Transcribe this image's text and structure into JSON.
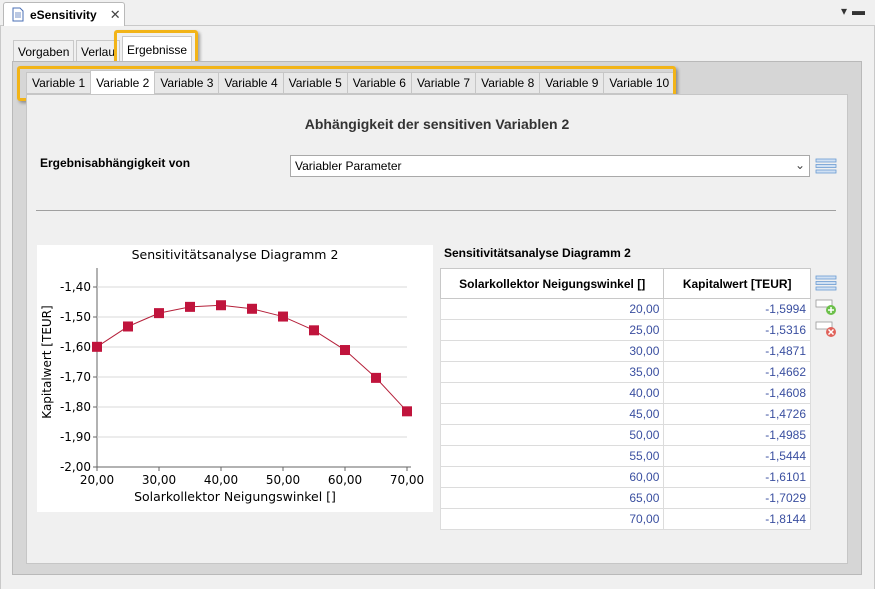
{
  "editor_tab": {
    "title": "eSensitivity"
  },
  "main_tabs": [
    {
      "label": "Vorgaben"
    },
    {
      "label": "Verlau"
    },
    {
      "label": "Ergebnisse"
    }
  ],
  "variable_tabs": [
    {
      "label": "Variable 1"
    },
    {
      "label": "Variable 2"
    },
    {
      "label": "Variable 3"
    },
    {
      "label": "Variable 4"
    },
    {
      "label": "Variable 5"
    },
    {
      "label": "Variable 6"
    },
    {
      "label": "Variable 7"
    },
    {
      "label": "Variable 8"
    },
    {
      "label": "Variable 9"
    },
    {
      "label": "Variable 10"
    }
  ],
  "active_variable_tab": "Variable 2",
  "section_title": "Abhängigkeit der sensitiven Variablen 2",
  "dependency": {
    "label": "Ergebnisabhängigkeit von",
    "selected": "Variabler Parameter"
  },
  "highlight_color": "#f2b418",
  "chart_data": {
    "type": "line",
    "title": "Sensitivitätsanalyse Diagramm 2",
    "xlabel": "Solarkollektor Neigungswinkel []",
    "ylabel": "Kapitalwert [TEUR]",
    "x": [
      20,
      25,
      30,
      35,
      40,
      45,
      50,
      55,
      60,
      65,
      70
    ],
    "values": [
      -1.5994,
      -1.5316,
      -1.4871,
      -1.4662,
      -1.4608,
      -1.4726,
      -1.4985,
      -1.5444,
      -1.6101,
      -1.7029,
      -1.8144
    ],
    "xlim": [
      20,
      70
    ],
    "ylim": [
      -2.0,
      -1.35
    ],
    "x_ticks": [
      "20,00",
      "30,00",
      "40,00",
      "50,00",
      "60,00",
      "70,00"
    ],
    "y_ticks": [
      "-1,40",
      "-1,50",
      "-1,60",
      "-1,70",
      "-1,80",
      "-1,90",
      "-2,00"
    ],
    "grid": true,
    "line_color": "#b5203a",
    "marker_color": "#c0143c"
  },
  "table": {
    "title": "Sensitivitätsanalyse Diagramm 2",
    "columns": [
      "Solarkollektor Neigungswinkel []",
      "Kapitalwert [TEUR]"
    ],
    "rows": [
      [
        "20,00",
        "-1,5994"
      ],
      [
        "25,00",
        "-1,5316"
      ],
      [
        "30,00",
        "-1,4871"
      ],
      [
        "35,00",
        "-1,4662"
      ],
      [
        "40,00",
        "-1,4608"
      ],
      [
        "45,00",
        "-1,4726"
      ],
      [
        "50,00",
        "-1,4985"
      ],
      [
        "55,00",
        "-1,5444"
      ],
      [
        "60,00",
        "-1,6101"
      ],
      [
        "65,00",
        "-1,7029"
      ],
      [
        "70,00",
        "-1,8144"
      ]
    ]
  },
  "icons": {
    "list": "list-icon",
    "add_row": "add-row-icon",
    "remove_row": "remove-row-icon"
  }
}
